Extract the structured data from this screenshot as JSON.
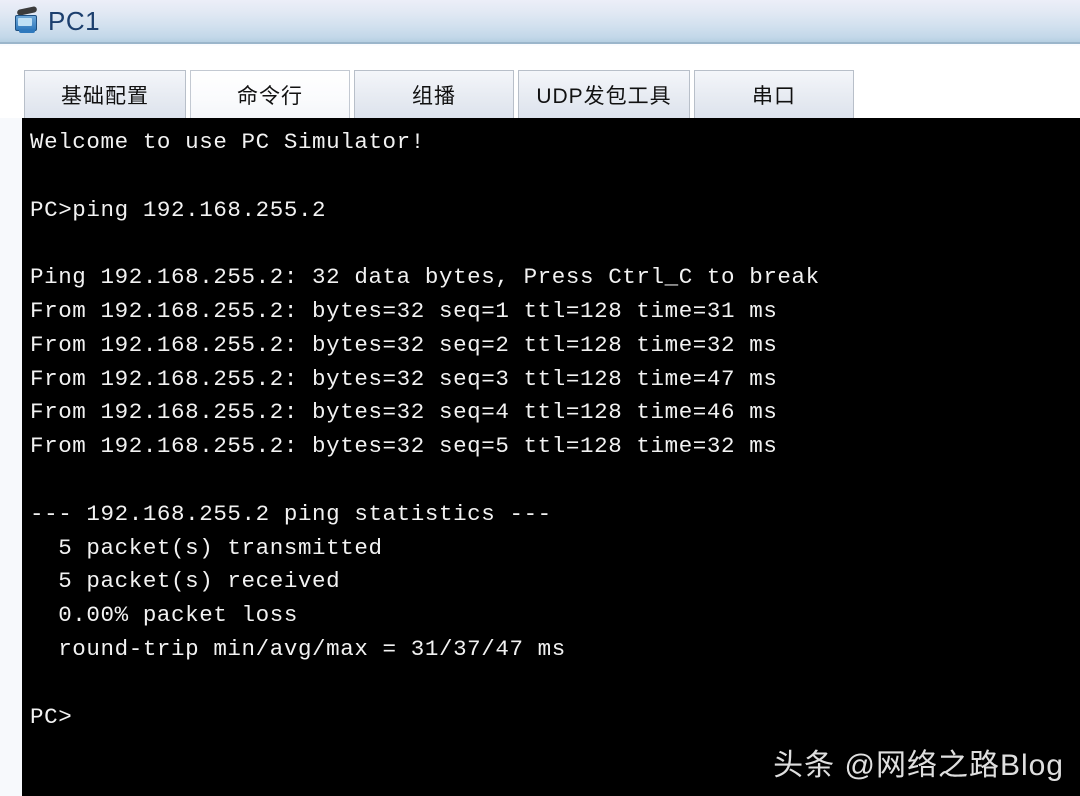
{
  "window": {
    "title": "PC1",
    "icon": "pc-monitor-icon"
  },
  "tabs": [
    {
      "label": "基础配置",
      "active": false
    },
    {
      "label": "命令行",
      "active": true
    },
    {
      "label": "组播",
      "active": false
    },
    {
      "label": "UDP发包工具",
      "active": false
    },
    {
      "label": "串口",
      "active": false
    }
  ],
  "terminal": {
    "background_color": "#000000",
    "text_color": "#f2f2f2",
    "lines": [
      "Welcome to use PC Simulator!",
      "",
      "PC>ping 192.168.255.2",
      "",
      "Ping 192.168.255.2: 32 data bytes, Press Ctrl_C to break",
      "From 192.168.255.2: bytes=32 seq=1 ttl=128 time=31 ms",
      "From 192.168.255.2: bytes=32 seq=2 ttl=128 time=32 ms",
      "From 192.168.255.2: bytes=32 seq=3 ttl=128 time=47 ms",
      "From 192.168.255.2: bytes=32 seq=4 ttl=128 time=46 ms",
      "From 192.168.255.2: bytes=32 seq=5 ttl=128 time=32 ms",
      "",
      "--- 192.168.255.2 ping statistics ---",
      "  5 packet(s) transmitted",
      "  5 packet(s) received",
      "  0.00% packet loss",
      "  round-trip min/avg/max = 31/37/47 ms",
      "",
      "PC>"
    ],
    "ping": {
      "target": "192.168.255.2",
      "data_bytes": 32,
      "break_hint": "Press Ctrl_C to break",
      "replies": [
        {
          "seq": 1,
          "bytes": 32,
          "ttl": 128,
          "time_ms": 31
        },
        {
          "seq": 2,
          "bytes": 32,
          "ttl": 128,
          "time_ms": 32
        },
        {
          "seq": 3,
          "bytes": 32,
          "ttl": 128,
          "time_ms": 47
        },
        {
          "seq": 4,
          "bytes": 32,
          "ttl": 128,
          "time_ms": 46
        },
        {
          "seq": 5,
          "bytes": 32,
          "ttl": 128,
          "time_ms": 32
        }
      ],
      "statistics": {
        "transmitted": 5,
        "received": 5,
        "packet_loss": "0.00%",
        "round_trip_min": 31,
        "round_trip_avg": 37,
        "round_trip_max": 47,
        "round_trip_unit": "ms"
      }
    },
    "prompt": "PC>"
  },
  "watermark": {
    "text": "头条 @网络之路Blog"
  }
}
